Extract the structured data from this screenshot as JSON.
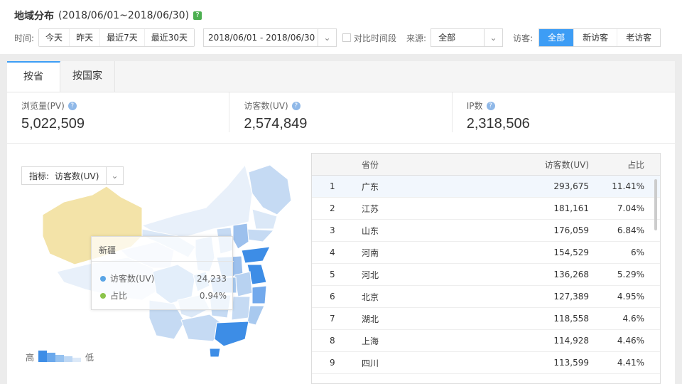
{
  "header": {
    "title": "地域分布",
    "date_range": "(2018/06/01~2018/06/30)",
    "help": "?"
  },
  "filters": {
    "time_label": "时间:",
    "time_options": [
      "今天",
      "昨天",
      "最近7天",
      "最近30天"
    ],
    "date_value": "2018/06/01 - 2018/06/30",
    "compare_label": "对比时间段",
    "source_label": "来源:",
    "source_value": "全部",
    "visitor_label": "访客:",
    "visitor_options": [
      "全部",
      "新访客",
      "老访客"
    ],
    "visitor_active": "全部"
  },
  "tabs": [
    "按省",
    "按国家"
  ],
  "active_tab": "按省",
  "kpis": [
    {
      "label": "浏览量(PV)",
      "value": "5,022,509"
    },
    {
      "label": "访客数(UV)",
      "value": "2,574,849"
    },
    {
      "label": "IP数",
      "value": "2,318,506"
    }
  ],
  "map": {
    "metric_label": "指标:",
    "metric_value": "访客数(UV)",
    "legend_high": "高",
    "legend_low": "低",
    "tooltip": {
      "title": "新疆",
      "rows": [
        {
          "label": "访客数(UV)",
          "value": "24,233",
          "color": "#5aa5e6"
        },
        {
          "label": "占比",
          "value": "0.94%",
          "color": "#8bc34a"
        }
      ]
    },
    "colors": {
      "high": "#3d8de6",
      "mid": "#a8c9ef",
      "low": "#e4eefa",
      "selected": "#f3e3a8"
    }
  },
  "table": {
    "headers": {
      "province": "省份",
      "uv": "访客数(UV)",
      "pct": "占比"
    },
    "rows": [
      {
        "idx": "1",
        "province": "广东",
        "uv": "293,675",
        "pct": "11.41%"
      },
      {
        "idx": "2",
        "province": "江苏",
        "uv": "181,161",
        "pct": "7.04%"
      },
      {
        "idx": "3",
        "province": "山东",
        "uv": "176,059",
        "pct": "6.84%"
      },
      {
        "idx": "4",
        "province": "河南",
        "uv": "154,529",
        "pct": "6%"
      },
      {
        "idx": "5",
        "province": "河北",
        "uv": "136,268",
        "pct": "5.29%"
      },
      {
        "idx": "6",
        "province": "北京",
        "uv": "127,389",
        "pct": "4.95%"
      },
      {
        "idx": "7",
        "province": "湖北",
        "uv": "118,558",
        "pct": "4.6%"
      },
      {
        "idx": "8",
        "province": "上海",
        "uv": "114,928",
        "pct": "4.46%"
      },
      {
        "idx": "9",
        "province": "四川",
        "uv": "113,599",
        "pct": "4.41%"
      }
    ]
  }
}
